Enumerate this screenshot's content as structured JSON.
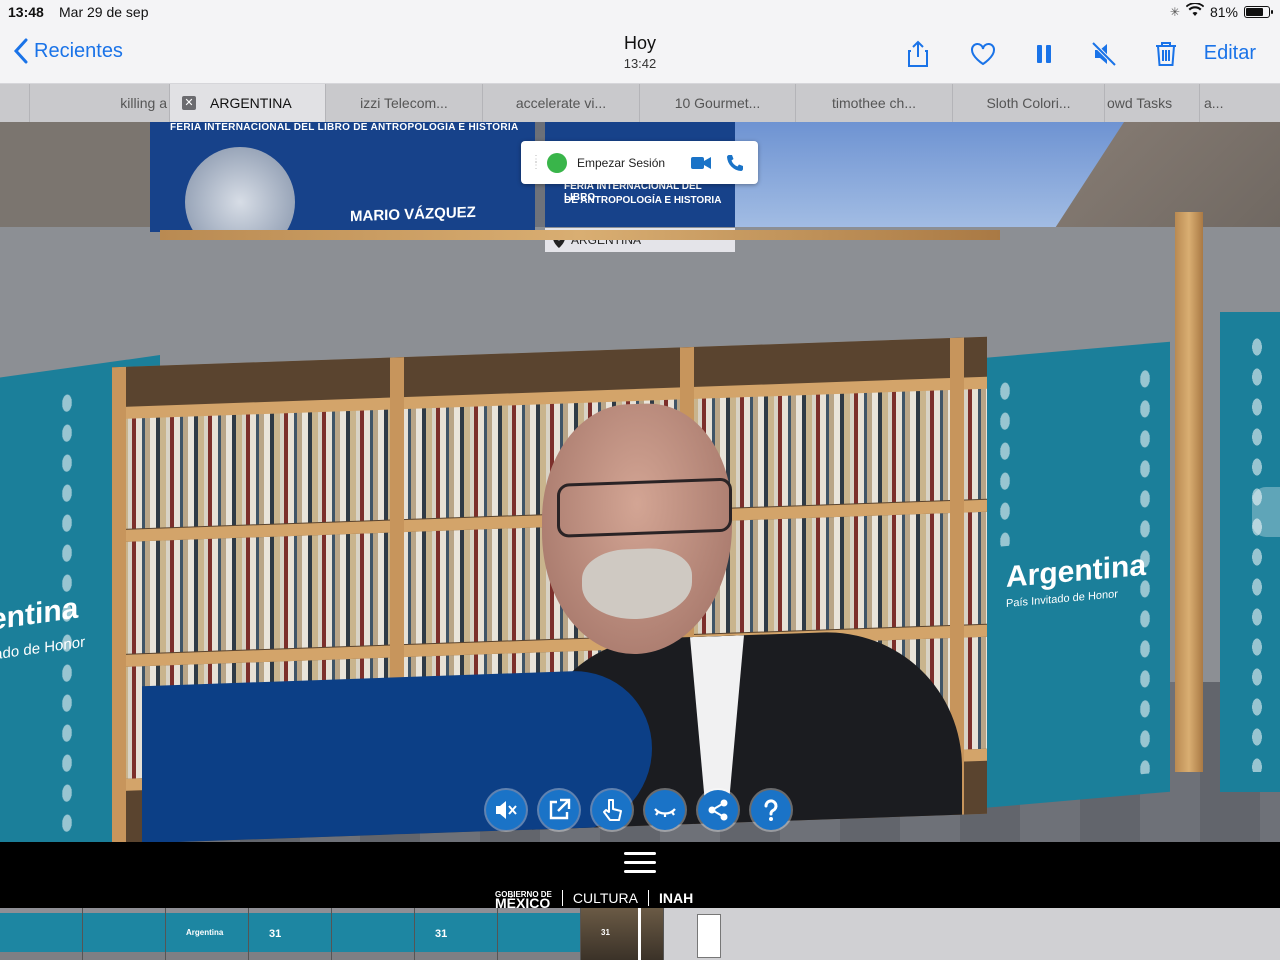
{
  "status": {
    "time": "13:48",
    "date": "Mar 29 de sep",
    "battery": "81%",
    "battery_level": 0.81
  },
  "nav": {
    "back_label": "Recientes",
    "title": "Hoy",
    "subtitle": "13:42",
    "edit_label": "Editar"
  },
  "tabs": [
    {
      "label": "killing a"
    },
    {
      "label": "ARGENTINA",
      "active": true
    },
    {
      "label": "izzi Telecom..."
    },
    {
      "label": "accelerate vi..."
    },
    {
      "label": "10 Gourmet..."
    },
    {
      "label": "timothee ch..."
    },
    {
      "label": "Sloth Colori..."
    },
    {
      "label": "owd Tasks"
    },
    {
      "label": "a..."
    }
  ],
  "scene": {
    "banner_header": "FERIA INTERNACIONAL DEL LIBRO DE ANTROPOLOGÍA E HISTORIA",
    "banner_name": "MARIO VÁZQUEZ",
    "banner2_line1": "FERIA INTERNACIONAL DEL LIBRO",
    "banner2_line2": "DE ANTROPOLOGÍA E HISTORIA",
    "popup_label": "Empezar Sesión",
    "location": "ARGENTINA",
    "right_panel_title": "Argentina",
    "right_panel_sub": "País Invitado de Honor",
    "left_panel_title": "entina",
    "left_panel_sub": "tado de Honor"
  },
  "tools": [
    "mute-icon",
    "external-link-icon",
    "hand-pointer-icon",
    "eye-closed-icon",
    "share-icon",
    "help-icon"
  ],
  "footer": {
    "logo1_line1": "GOBIERNO DE",
    "logo1_line2": "MÉXICO",
    "logo2": "CULTURA",
    "logo3": "INAH"
  },
  "timeline": {
    "thumb_labels": [
      "",
      "",
      "Argentina",
      "31",
      "",
      "31",
      "",
      "31",
      ""
    ]
  },
  "colors": {
    "accent": "#1a73e8",
    "panel": "#1b7f9a",
    "banner": "#17428a",
    "tool": "#1a73c7"
  }
}
